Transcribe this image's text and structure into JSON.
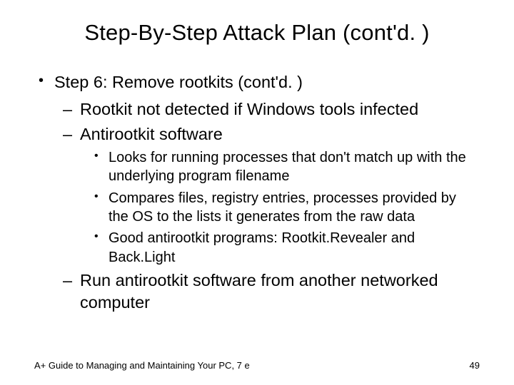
{
  "title": "Step-By-Step Attack Plan (cont'd. )",
  "bullets": {
    "l1": "Step 6: Remove rootkits (cont'd. )",
    "l2a": "Rootkit not detected if Windows tools infected",
    "l2b": "Antirootkit software",
    "l3a": "Looks for running processes that don't match up with the underlying program filename",
    "l3b": "Compares files, registry entries, processes provided by the OS to the lists it generates from the raw data",
    "l3c": "Good antirootkit programs: Rootkit.Revealer and Back.Light",
    "l2c": "Run antirootkit software from another networked computer"
  },
  "footer": {
    "left": "A+ Guide to Managing and Maintaining Your PC, 7 e",
    "right": "49"
  }
}
